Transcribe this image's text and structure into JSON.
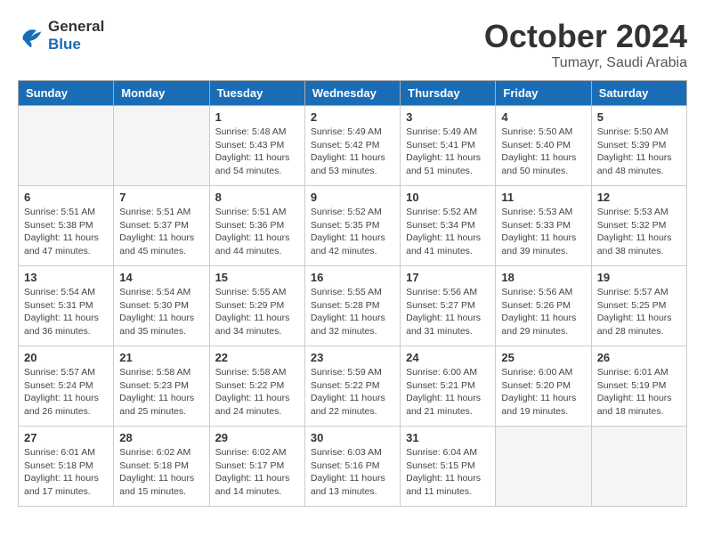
{
  "header": {
    "logo_line1": "General",
    "logo_line2": "Blue",
    "month": "October 2024",
    "location": "Tumayr, Saudi Arabia"
  },
  "days_of_week": [
    "Sunday",
    "Monday",
    "Tuesday",
    "Wednesday",
    "Thursday",
    "Friday",
    "Saturday"
  ],
  "weeks": [
    [
      {
        "day": "",
        "info": ""
      },
      {
        "day": "",
        "info": ""
      },
      {
        "day": "1",
        "sunrise": "5:48 AM",
        "sunset": "5:43 PM",
        "daylight": "11 hours and 54 minutes."
      },
      {
        "day": "2",
        "sunrise": "5:49 AM",
        "sunset": "5:42 PM",
        "daylight": "11 hours and 53 minutes."
      },
      {
        "day": "3",
        "sunrise": "5:49 AM",
        "sunset": "5:41 PM",
        "daylight": "11 hours and 51 minutes."
      },
      {
        "day": "4",
        "sunrise": "5:50 AM",
        "sunset": "5:40 PM",
        "daylight": "11 hours and 50 minutes."
      },
      {
        "day": "5",
        "sunrise": "5:50 AM",
        "sunset": "5:39 PM",
        "daylight": "11 hours and 48 minutes."
      }
    ],
    [
      {
        "day": "6",
        "sunrise": "5:51 AM",
        "sunset": "5:38 PM",
        "daylight": "11 hours and 47 minutes."
      },
      {
        "day": "7",
        "sunrise": "5:51 AM",
        "sunset": "5:37 PM",
        "daylight": "11 hours and 45 minutes."
      },
      {
        "day": "8",
        "sunrise": "5:51 AM",
        "sunset": "5:36 PM",
        "daylight": "11 hours and 44 minutes."
      },
      {
        "day": "9",
        "sunrise": "5:52 AM",
        "sunset": "5:35 PM",
        "daylight": "11 hours and 42 minutes."
      },
      {
        "day": "10",
        "sunrise": "5:52 AM",
        "sunset": "5:34 PM",
        "daylight": "11 hours and 41 minutes."
      },
      {
        "day": "11",
        "sunrise": "5:53 AM",
        "sunset": "5:33 PM",
        "daylight": "11 hours and 39 minutes."
      },
      {
        "day": "12",
        "sunrise": "5:53 AM",
        "sunset": "5:32 PM",
        "daylight": "11 hours and 38 minutes."
      }
    ],
    [
      {
        "day": "13",
        "sunrise": "5:54 AM",
        "sunset": "5:31 PM",
        "daylight": "11 hours and 36 minutes."
      },
      {
        "day": "14",
        "sunrise": "5:54 AM",
        "sunset": "5:30 PM",
        "daylight": "11 hours and 35 minutes."
      },
      {
        "day": "15",
        "sunrise": "5:55 AM",
        "sunset": "5:29 PM",
        "daylight": "11 hours and 34 minutes."
      },
      {
        "day": "16",
        "sunrise": "5:55 AM",
        "sunset": "5:28 PM",
        "daylight": "11 hours and 32 minutes."
      },
      {
        "day": "17",
        "sunrise": "5:56 AM",
        "sunset": "5:27 PM",
        "daylight": "11 hours and 31 minutes."
      },
      {
        "day": "18",
        "sunrise": "5:56 AM",
        "sunset": "5:26 PM",
        "daylight": "11 hours and 29 minutes."
      },
      {
        "day": "19",
        "sunrise": "5:57 AM",
        "sunset": "5:25 PM",
        "daylight": "11 hours and 28 minutes."
      }
    ],
    [
      {
        "day": "20",
        "sunrise": "5:57 AM",
        "sunset": "5:24 PM",
        "daylight": "11 hours and 26 minutes."
      },
      {
        "day": "21",
        "sunrise": "5:58 AM",
        "sunset": "5:23 PM",
        "daylight": "11 hours and 25 minutes."
      },
      {
        "day": "22",
        "sunrise": "5:58 AM",
        "sunset": "5:22 PM",
        "daylight": "11 hours and 24 minutes."
      },
      {
        "day": "23",
        "sunrise": "5:59 AM",
        "sunset": "5:22 PM",
        "daylight": "11 hours and 22 minutes."
      },
      {
        "day": "24",
        "sunrise": "6:00 AM",
        "sunset": "5:21 PM",
        "daylight": "11 hours and 21 minutes."
      },
      {
        "day": "25",
        "sunrise": "6:00 AM",
        "sunset": "5:20 PM",
        "daylight": "11 hours and 19 minutes."
      },
      {
        "day": "26",
        "sunrise": "6:01 AM",
        "sunset": "5:19 PM",
        "daylight": "11 hours and 18 minutes."
      }
    ],
    [
      {
        "day": "27",
        "sunrise": "6:01 AM",
        "sunset": "5:18 PM",
        "daylight": "11 hours and 17 minutes."
      },
      {
        "day": "28",
        "sunrise": "6:02 AM",
        "sunset": "5:18 PM",
        "daylight": "11 hours and 15 minutes."
      },
      {
        "day": "29",
        "sunrise": "6:02 AM",
        "sunset": "5:17 PM",
        "daylight": "11 hours and 14 minutes."
      },
      {
        "day": "30",
        "sunrise": "6:03 AM",
        "sunset": "5:16 PM",
        "daylight": "11 hours and 13 minutes."
      },
      {
        "day": "31",
        "sunrise": "6:04 AM",
        "sunset": "5:15 PM",
        "daylight": "11 hours and 11 minutes."
      },
      {
        "day": "",
        "info": ""
      },
      {
        "day": "",
        "info": ""
      }
    ]
  ]
}
